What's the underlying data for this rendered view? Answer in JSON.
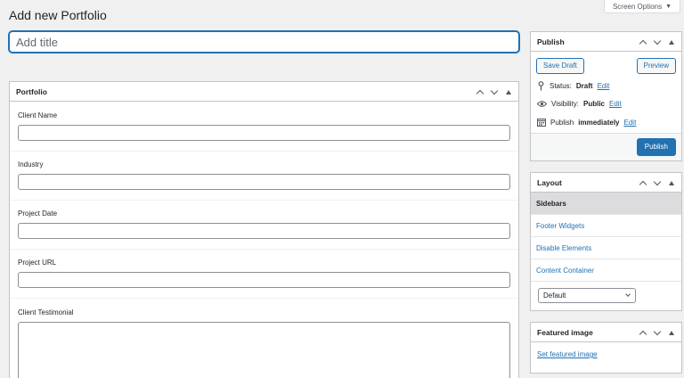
{
  "page": {
    "title": "Add new Portfolio",
    "screen_options": "Screen Options",
    "title_placeholder": "Add title"
  },
  "portfolio": {
    "title": "Portfolio",
    "fields": {
      "client_name": "Client Name",
      "industry": "Industry",
      "project_date": "Project Date",
      "project_url": "Project URL",
      "client_testimonial": "Client Testimonial"
    }
  },
  "publish": {
    "title": "Publish",
    "save_draft": "Save Draft",
    "preview": "Preview",
    "status_label": "Status:",
    "status_value": "Draft",
    "visibility_label": "Visibility:",
    "visibility_value": "Public",
    "publish_label": "Publish",
    "publish_value": "immediately",
    "edit": "Edit",
    "publish_button": "Publish"
  },
  "layout": {
    "title": "Layout",
    "tabs": [
      "Sidebars",
      "Footer Widgets",
      "Disable Elements",
      "Content Container"
    ],
    "select_value": "Default"
  },
  "featured": {
    "title": "Featured image",
    "link": "Set featured image"
  },
  "colors": {
    "accent": "#2271b1",
    "background": "#f0f0f1"
  }
}
